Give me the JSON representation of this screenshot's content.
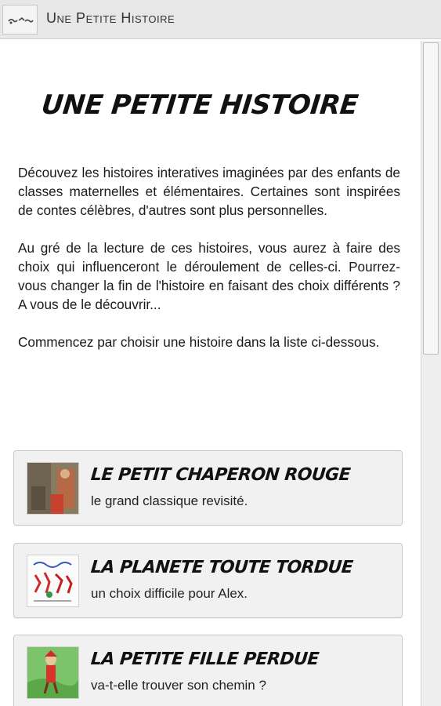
{
  "app": {
    "title": "Une Petite Histoire",
    "icon": "app-logo-icon"
  },
  "main": {
    "heading": "UNE PETITE HISTOIRE",
    "intro": [
      "Découvez les histoires interatives imaginées par des enfants de classes maternelles et élémentaires. Certaines sont inspirées de contes célèbres, d'autres sont plus personnelles.",
      "Au gré de la lecture de ces histoires, vous aurez à faire des choix qui influenceront le déroulement de celles-ci. Pourrez-vous changer la fin de l'histoire en faisant des choix différents ? A vous de le découvrir...",
      "Commencez par choisir une histoire dans la liste ci-dessous."
    ],
    "stories": [
      {
        "title": "LE PETIT CHAPERON ROUGE",
        "subtitle": "le grand classique revisité."
      },
      {
        "title": "LA PLANETE TOUTE TORDUE",
        "subtitle": "un choix difficile pour Alex."
      },
      {
        "title": "LA PETITE FILLE PERDUE",
        "subtitle": "va-t-elle trouver son chemin ?"
      }
    ]
  },
  "colors": {
    "titlebar_bg": "#e7e7e7",
    "card_bg": "#f1f1f1",
    "card_border": "#c9c9c9"
  }
}
